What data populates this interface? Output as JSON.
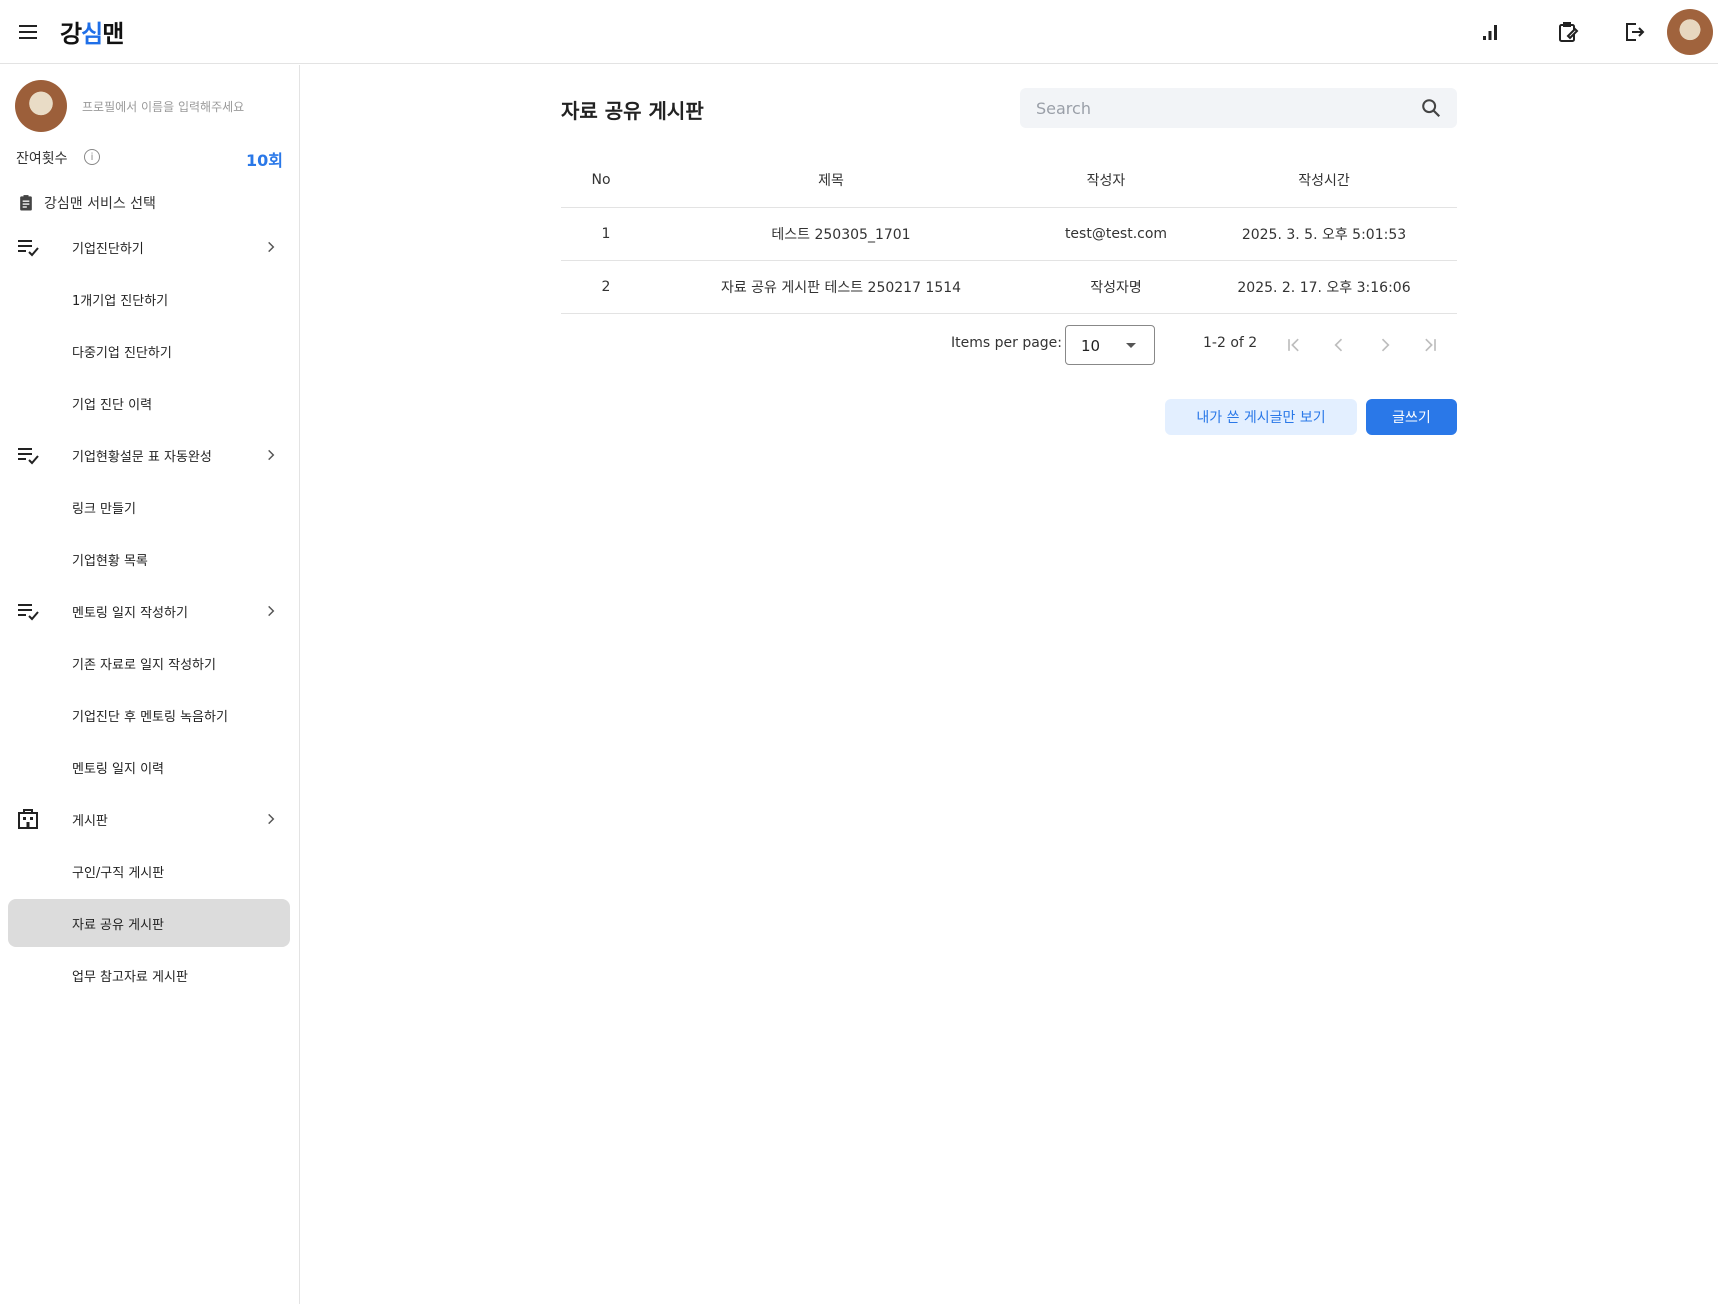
{
  "header": {
    "logo_text": "강",
    "logo_ai": "심",
    "logo_tail": "맨",
    "icons": [
      "bar-chart-icon",
      "clipboard-edit-icon",
      "logout-icon"
    ]
  },
  "sidebar": {
    "profile_placeholder": "프로필에서 이름을 입력해주세요",
    "credits_label": "잔여횟수",
    "credits_value": "10회",
    "service_title": "강심맨 서비스 선택",
    "groups": [
      {
        "label": "기업진단하기",
        "items": [
          "1개기업 진단하기",
          "다중기업 진단하기",
          "기업 진단 이력"
        ]
      },
      {
        "label": "기업현황설문 표 자동완성",
        "items": [
          "링크 만들기",
          "기업현황 목록"
        ]
      },
      {
        "label": "멘토링 일지 작성하기",
        "items": [
          "기존 자료로 일지 작성하기",
          "기업진단 후 멘토링 녹음하기",
          "멘토링 일지 이력"
        ]
      },
      {
        "label": "게시판",
        "items": [
          "구인/구직 게시판",
          "자료 공유 게시판",
          "업무 참고자료 게시판"
        ]
      }
    ],
    "active_item": "자료 공유 게시판"
  },
  "main": {
    "title": "자료 공유 게시판",
    "search_placeholder": "Search",
    "columns": [
      "No",
      "제목",
      "작성자",
      "작성시간"
    ],
    "rows": [
      {
        "no": "1",
        "title": "테스트 250305_1701",
        "author": "test@test.com",
        "time": "2025. 3. 5. 오후 5:01:53"
      },
      {
        "no": "2",
        "title": "자료 공유 게시판 테스트 250217 1514",
        "author": "작성자명",
        "time": "2025. 2. 17. 오후 3:16:06"
      }
    ],
    "pagination": {
      "items_per_page_label": "Items per page:",
      "items_per_page_value": "10",
      "range": "1-2 of 2"
    },
    "buttons": {
      "my_posts": "내가 쓴 게시글만 보기",
      "write": "글쓰기"
    }
  }
}
